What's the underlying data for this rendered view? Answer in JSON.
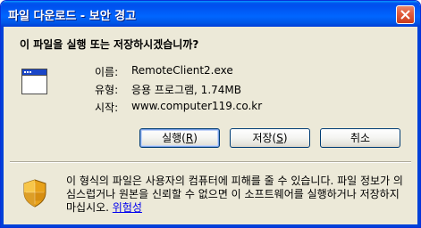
{
  "window": {
    "title": "파일 다운로드 - 보안 경고"
  },
  "question": "이 파일을 실행 또는 저장하시겠습니까?",
  "file_info": {
    "name_label": "이름:",
    "name_value": "RemoteClient2.exe",
    "type_label": "유형:",
    "type_value": "응용 프로그램, 1.74MB",
    "from_label": "시작:",
    "from_value": "www.computer119.co.kr"
  },
  "buttons": {
    "run": {
      "prefix": "실행(",
      "key": "R",
      "suffix": ")"
    },
    "save": {
      "prefix": "저장(",
      "key": "S",
      "suffix": ")"
    },
    "cancel": "취소"
  },
  "warning": {
    "text": "이 형식의 파일은 사용자의 컴퓨터에 피해를 줄 수 있습니다. 파일 정보가 의심스럽거나 원본을 신뢰할 수 없으면 이 소프트웨어를 실행하거나 저장하지 마십시오. ",
    "link": "위험성"
  },
  "icons": {
    "close": "close-icon",
    "file": "application-window-icon",
    "warning": "security-shield-icon"
  }
}
